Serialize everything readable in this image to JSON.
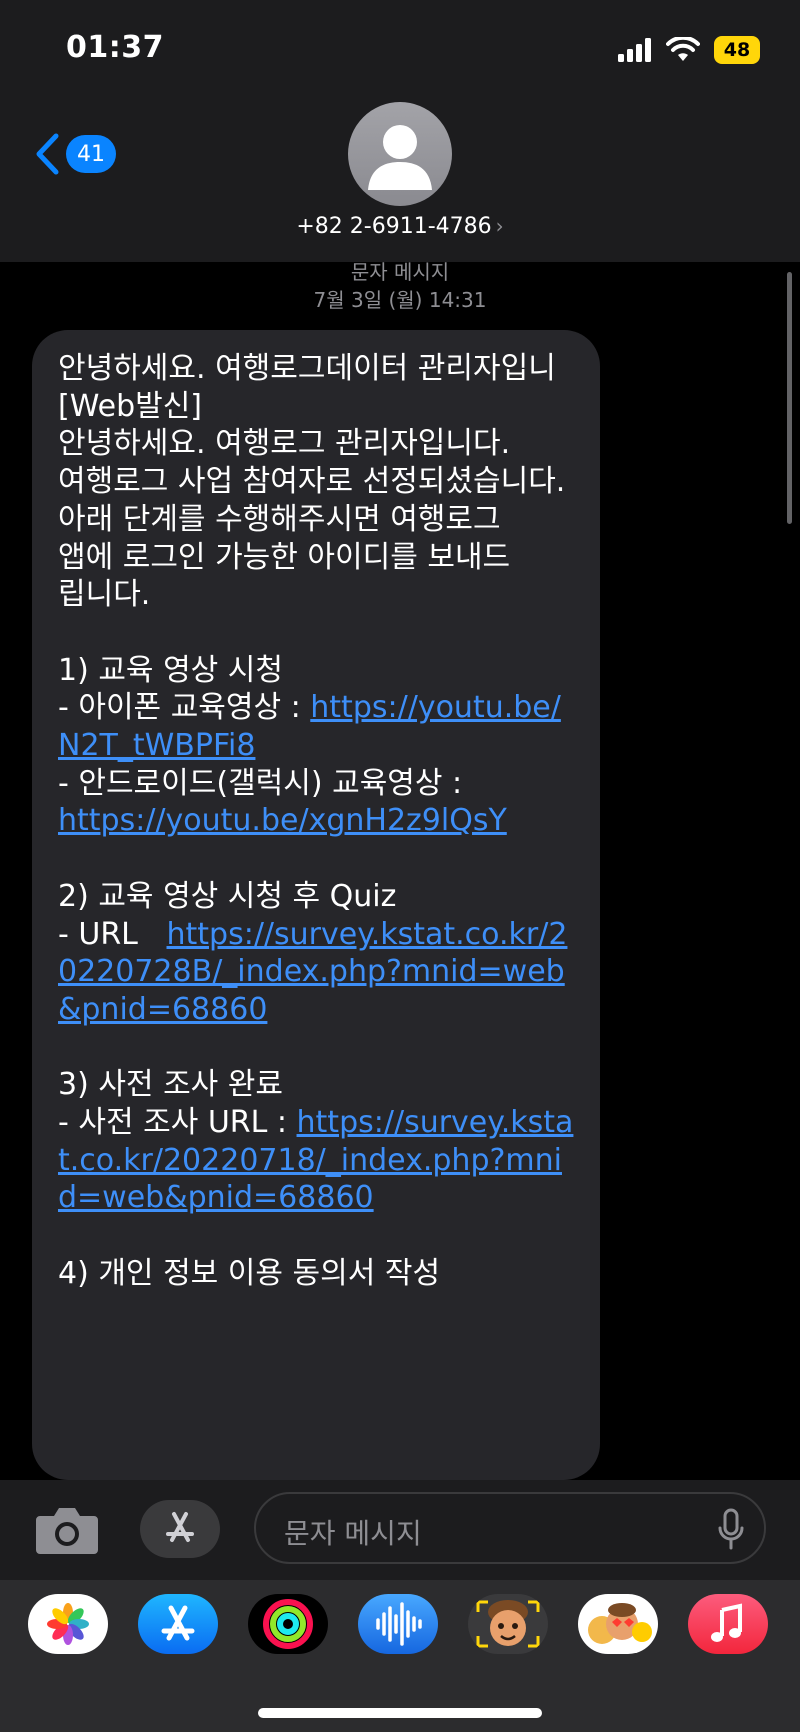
{
  "status": {
    "time": "01:37",
    "battery": "48"
  },
  "nav": {
    "back_count": "41"
  },
  "contact": {
    "number": "+82 2-6911-4786",
    "chevron": "›"
  },
  "thread": {
    "service": "문자 메시지",
    "timestamp": "7월 3일 (월) 14:31"
  },
  "message": {
    "p1": "안녕하세요. 여행로그데이터 관리자입니\n[Web발신]\n안녕하세요. 여행로그 관리자입니다.\n여행로그 사업 참여자로 선정되셨습니다.\n아래 단계를 수행해주시면 여행로그\n앱에 로그인 가능한 아이디를 보내드\n립니다.\n\n1) 교육 영상 시청\n- 아이폰 교육영상 : ",
    "link1": "https://youtu.be/N2T_tWBPFi8",
    "p2": "\n- 안드로이드(갤럭시) 교육영상 :\n",
    "link2": "https://youtu.be/xgnH2z9lQsY",
    "p3": "\n\n2) 교육 영상 시청 후 Quiz\n- URL   ",
    "link3": "https://survey.kstat.co.kr/20220728B/_index.php?mnid=web&pnid=68860",
    "p4": "\n\n3) 사전 조사 완료\n- 사전 조사 URL : ",
    "link4": "https://survey.kstat.co.kr/20220718/_index.php?mnid=web&pnid=68860",
    "p5": "\n\n4) 개인 정보 이용 동의서 작성"
  },
  "compose": {
    "placeholder": "문자 메시지"
  },
  "app_drawer": [
    "photos-icon",
    "app-store-icon",
    "activity-icon",
    "audio-icon",
    "memoji-icon",
    "memoji-stickers-icon",
    "music-icon"
  ],
  "colors": {
    "link": "#3e8ff8",
    "accent": "#0a84ff",
    "battery": "#ffd60a"
  }
}
